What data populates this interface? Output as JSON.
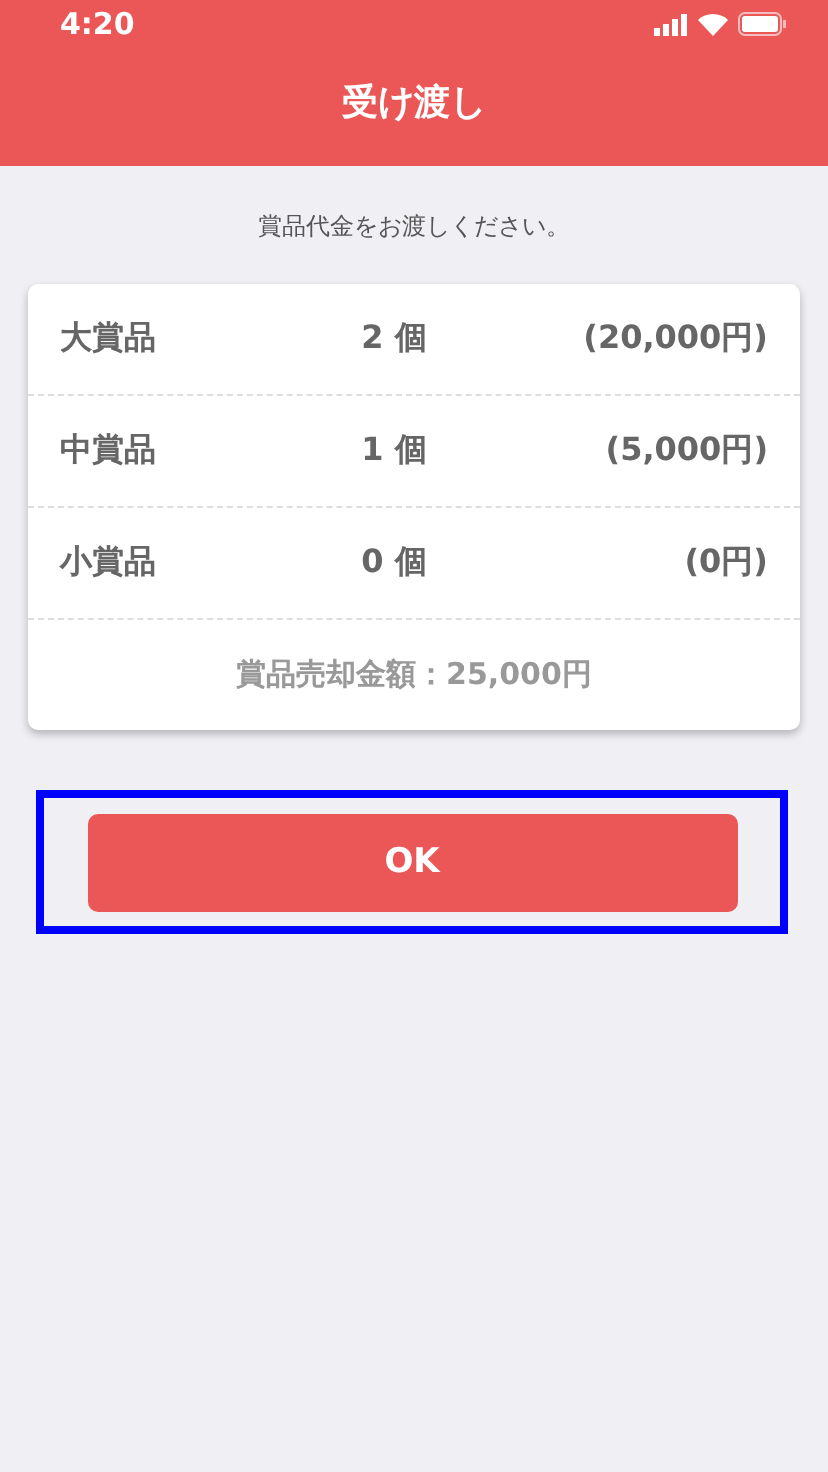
{
  "status_bar": {
    "time": "4:20"
  },
  "header": {
    "title": "受け渡し"
  },
  "instruction": "賞品代金をお渡しください。",
  "prizes": [
    {
      "name": "大賞品",
      "count": "2 個",
      "amount": "(20,000円)"
    },
    {
      "name": "中賞品",
      "count": "1 個",
      "amount": "(5,000円)"
    },
    {
      "name": "小賞品",
      "count": "0 個",
      "amount": "(0円)"
    }
  ],
  "total": "賞品売却金額：25,000円",
  "ok_button": {
    "label": "OK",
    "highlighted": true
  }
}
